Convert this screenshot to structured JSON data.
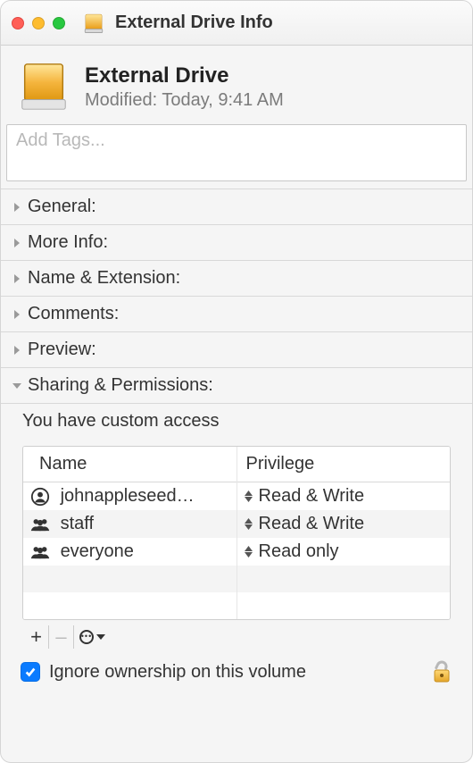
{
  "window": {
    "title": "External Drive Info"
  },
  "header": {
    "name": "External Drive",
    "modified_label": "Modified:",
    "modified_value": "Today, 9:41 AM"
  },
  "tags": {
    "placeholder": "Add Tags..."
  },
  "sections": {
    "general": "General:",
    "more_info": "More Info:",
    "name_ext": "Name & Extension:",
    "comments": "Comments:",
    "preview": "Preview:",
    "sharing": "Sharing & Permissions:"
  },
  "permissions": {
    "access_text": "You have custom access",
    "columns": {
      "name": "Name",
      "privilege": "Privilege"
    },
    "rows": [
      {
        "icon": "person-icon",
        "name": "johnappleseed…",
        "privilege": "Read & Write"
      },
      {
        "icon": "group-icon",
        "name": "staff",
        "privilege": "Read & Write"
      },
      {
        "icon": "group-icon",
        "name": "everyone",
        "privilege": "Read only"
      }
    ],
    "toolbar": {
      "add": "+",
      "remove": "–"
    },
    "ignore_ownership_label": "Ignore ownership on this volume",
    "ignore_ownership_checked": true,
    "lock_state": "unlocked"
  }
}
